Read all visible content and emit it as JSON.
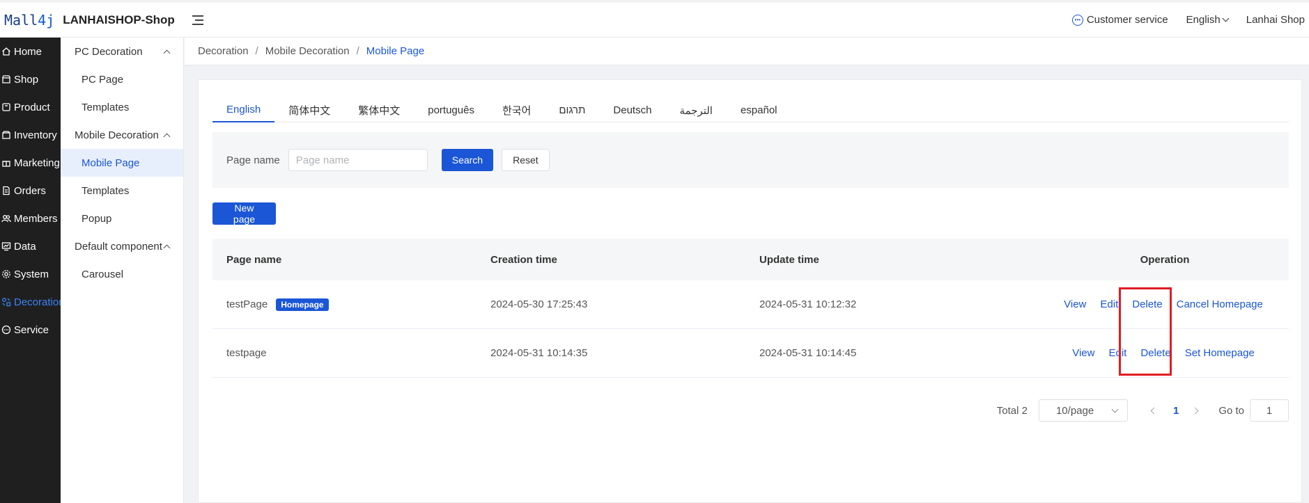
{
  "header": {
    "logo_mark_a": "Mall",
    "logo_mark_b": "4j",
    "app_title": "LANHAISHOP-Shop",
    "customer_service": "Customer service",
    "language": "English",
    "user": "Lanhai Shop"
  },
  "sidebar": {
    "items": [
      {
        "label": "Home",
        "icon": "home-icon"
      },
      {
        "label": "Shop",
        "icon": "shop-icon"
      },
      {
        "label": "Product",
        "icon": "product-icon"
      },
      {
        "label": "Inventory",
        "icon": "inventory-icon"
      },
      {
        "label": "Marketing",
        "icon": "gift-icon"
      },
      {
        "label": "Orders",
        "icon": "orders-icon"
      },
      {
        "label": "Members",
        "icon": "members-icon"
      },
      {
        "label": "Data",
        "icon": "data-icon"
      },
      {
        "label": "System",
        "icon": "gear-icon"
      },
      {
        "label": "Decoration",
        "icon": "decoration-icon",
        "active": true
      },
      {
        "label": "Service",
        "icon": "chat-icon"
      }
    ]
  },
  "submenu": {
    "pc_group": "PC Decoration",
    "pc_page": "PC Page",
    "pc_templates": "Templates",
    "mobile_group": "Mobile Decoration",
    "mobile_page": "Mobile Page",
    "mobile_templates": "Templates",
    "popup": "Popup",
    "default_group": "Default component",
    "carousel": "Carousel"
  },
  "breadcrumb": {
    "level1": "Decoration",
    "level2": "Mobile Decoration",
    "current": "Mobile Page",
    "separator": "/"
  },
  "tabs": [
    "English",
    "简体中文",
    "繁体中文",
    "português",
    "한국어",
    "תרגום",
    "Deutsch",
    "الترجمة",
    "español"
  ],
  "filter": {
    "label": "Page name",
    "placeholder": "Page name",
    "search": "Search",
    "reset": "Reset"
  },
  "new_page": "New page",
  "table": {
    "headers": {
      "name": "Page name",
      "created": "Creation time",
      "updated": "Update time",
      "operation": "Operation"
    },
    "rows": [
      {
        "name": "testPage",
        "badge": "Homepage",
        "created": "2024-05-30 17:25:43",
        "updated": "2024-05-31 10:12:32",
        "view": "View",
        "edit": "Edit",
        "delete": "Delete",
        "homepage_action": "Cancel Homepage"
      },
      {
        "name": "testpage",
        "badge": "",
        "created": "2024-05-31 10:14:35",
        "updated": "2024-05-31 10:14:45",
        "view": "View",
        "edit": "Edit",
        "delete": "Delete",
        "homepage_action": "Set Homepage"
      }
    ]
  },
  "pagination": {
    "total": "Total 2",
    "page_size": "10/page",
    "current_page": "1",
    "goto_label": "Go to",
    "goto_value": "1"
  },
  "colors": {
    "accent": "#1a56d6",
    "sidebar_bg": "#1f1f1f",
    "highlight": "#e31b23"
  }
}
